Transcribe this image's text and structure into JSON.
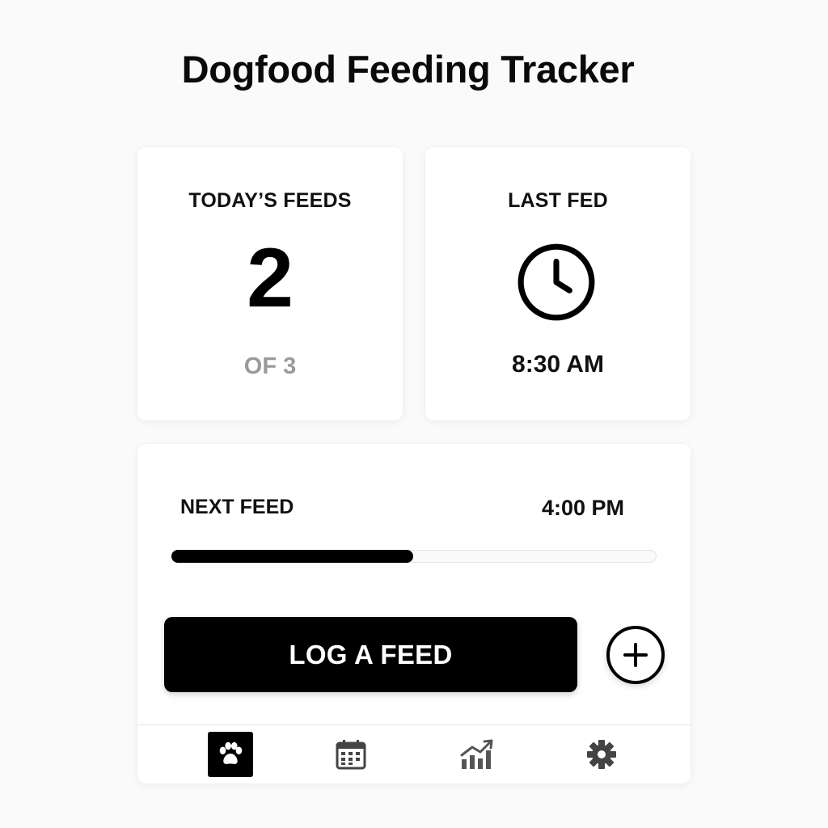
{
  "app": {
    "title": "Dogfood Feeding Tracker"
  },
  "todays_feeds": {
    "label": "TODAY’S FEEDS",
    "count": "2",
    "total_text": "OF 3",
    "count_value": 2,
    "total_value": 3
  },
  "last_fed": {
    "label": "LAST FED",
    "icon": "clock-icon",
    "time": "8:30 AM"
  },
  "next_feed": {
    "label": "NEXT FEED",
    "time": "4:00 PM",
    "progress_fraction": 0.5
  },
  "actions": {
    "log_label": "LOG A FEED",
    "add_icon": "plus-circle-icon"
  },
  "nav": {
    "items": [
      {
        "name": "paw-icon",
        "active": true
      },
      {
        "name": "calendar-icon",
        "active": false
      },
      {
        "name": "stats-icon",
        "active": false
      },
      {
        "name": "gear-icon",
        "active": false
      }
    ]
  },
  "colors": {
    "accent": "#000000",
    "muted_text": "#9a9a9a",
    "card_bg": "#ffffff",
    "page_bg": "#fafafa"
  }
}
